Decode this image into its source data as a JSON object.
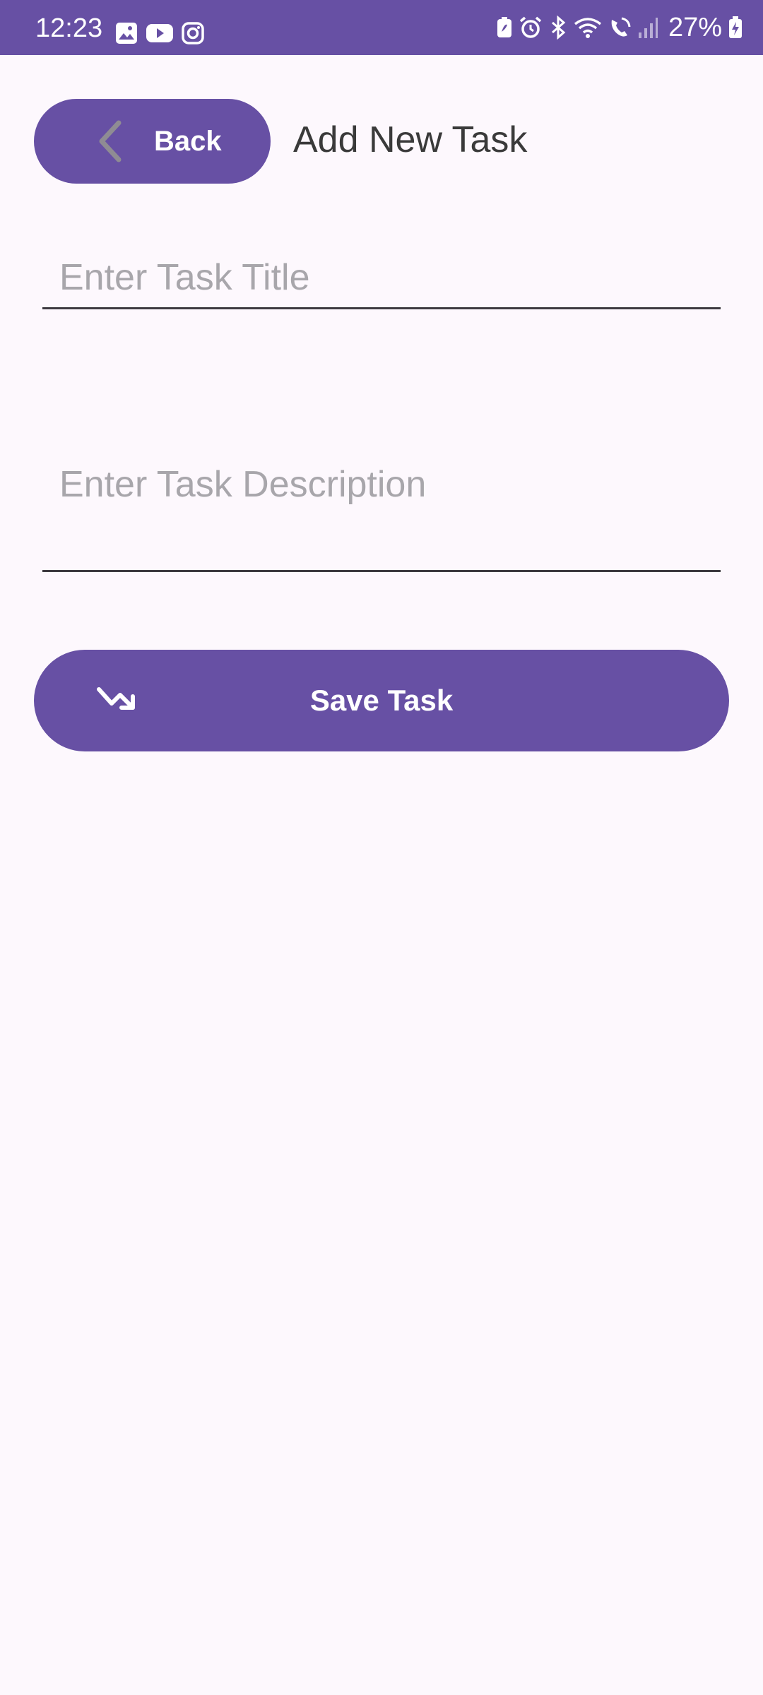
{
  "status_bar": {
    "time": "12:23",
    "battery_percent": "27%",
    "left_icons": [
      "gallery-icon",
      "youtube-icon",
      "instagram-icon"
    ],
    "right_icons": [
      "battery-saver-icon",
      "alarm-icon",
      "bluetooth-icon",
      "wifi-icon",
      "wifi-calling-icon",
      "signal-icon",
      "battery-charging-icon"
    ],
    "background_color": "#6750a4"
  },
  "header": {
    "back_label": "Back",
    "back_icon": "chevron-left-icon",
    "title": "Add New Task"
  },
  "form": {
    "title_placeholder": "Enter Task Title",
    "title_value": "",
    "description_placeholder": "Enter Task Description",
    "description_value": ""
  },
  "actions": {
    "save_label": "Save Task",
    "save_icon": "trending-down-arrow-icon"
  },
  "colors": {
    "accent": "#6750a4",
    "background": "#fdf8fd",
    "placeholder": "#a8a6ab",
    "title_text": "#3a3a3a"
  }
}
